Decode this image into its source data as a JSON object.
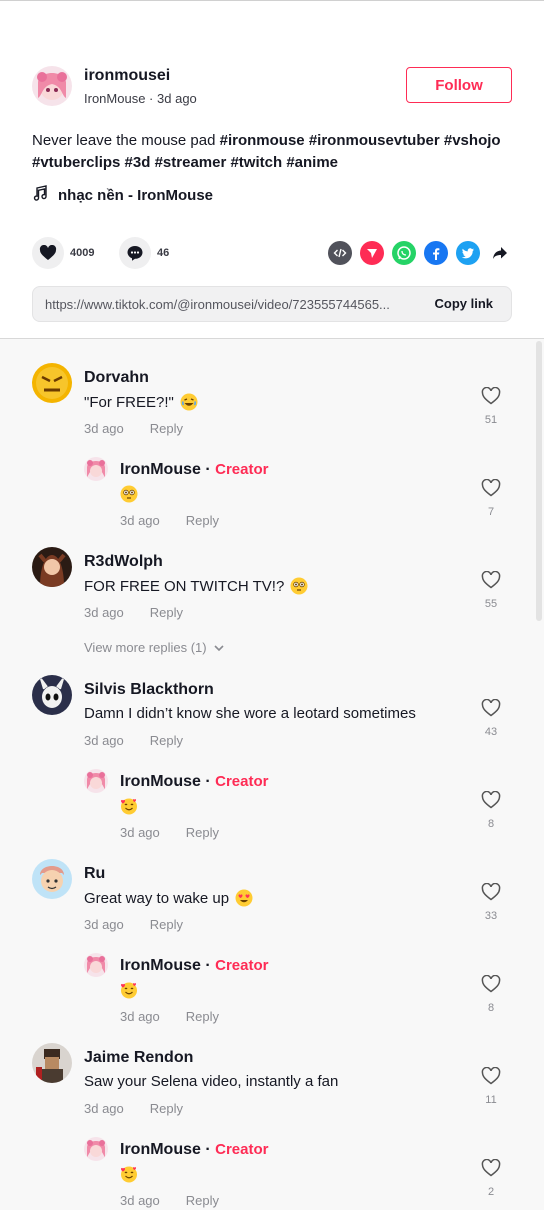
{
  "post": {
    "author_name": "ironmousei",
    "author_display": "IronMouse",
    "time_ago": "3d ago",
    "meta_separator": "·",
    "follow_label": "Follow",
    "description_text": "Never leave the mouse pad",
    "hashtags": [
      "#ironmouse",
      "#ironmousevtuber",
      "#vshojo",
      "#vtuberclips",
      "#3d",
      "#streamer",
      "#twitch",
      "#anime"
    ],
    "music": "nhạc nền - IronMouse",
    "likes": "4009",
    "comments": "46",
    "link": "https://www.tiktok.com/@ironmousei/video/723555744565...",
    "copy_label": "Copy link",
    "share_icons": [
      "embed-icon",
      "send-icon",
      "whatsapp-icon",
      "facebook-icon",
      "twitter-icon",
      "share-arrow-icon"
    ],
    "colors": {
      "accent": "#fe2c55",
      "whatsapp": "#25d366",
      "facebook": "#1877f2",
      "twitter": "#1da1f2"
    }
  },
  "comments": [
    {
      "name": "Dorvahn",
      "text": "\"For FREE?!\"",
      "emoji": "laughing-emoji",
      "time": "3d ago",
      "reply_label": "Reply",
      "likes": "51"
    },
    {
      "name": "IronMouse",
      "creator": "Creator",
      "separator": "·",
      "text": "",
      "emoji": "flushed-emoji",
      "time": "3d ago",
      "reply_label": "Reply",
      "likes": "7"
    },
    {
      "name": "R3dWolph",
      "text": "FOR FREE ON TWITCH TV!?",
      "emoji": "flushed-emoji",
      "time": "3d ago",
      "reply_label": "Reply",
      "likes": "55"
    },
    {
      "name": "Silvis Blackthorn",
      "text": "Damn I didn’t know she wore a leotard sometimes",
      "time": "3d ago",
      "reply_label": "Reply",
      "likes": "43"
    },
    {
      "name": "IronMouse",
      "creator": "Creator",
      "separator": "·",
      "text": "",
      "emoji": "smiling-hearts-emoji",
      "time": "3d ago",
      "reply_label": "Reply",
      "likes": "8"
    },
    {
      "name": "Ru",
      "text": "Great way to wake up",
      "emoji": "heart-eyes-emoji",
      "time": "3d ago",
      "reply_label": "Reply",
      "likes": "33"
    },
    {
      "name": "IronMouse",
      "creator": "Creator",
      "separator": "·",
      "text": "",
      "emoji": "smiling-hearts-emoji",
      "time": "3d ago",
      "reply_label": "Reply",
      "likes": "8"
    },
    {
      "name": "Jaime Rendon",
      "text": "Saw your Selena video, instantly a fan",
      "time": "3d ago",
      "reply_label": "Reply",
      "likes": "11"
    },
    {
      "name": "IronMouse",
      "creator": "Creator",
      "separator": "·",
      "text": "",
      "emoji": "smiling-hearts-emoji",
      "time": "3d ago",
      "reply_label": "Reply",
      "likes": "2"
    }
  ],
  "view_more_replies": "View more replies (1)"
}
